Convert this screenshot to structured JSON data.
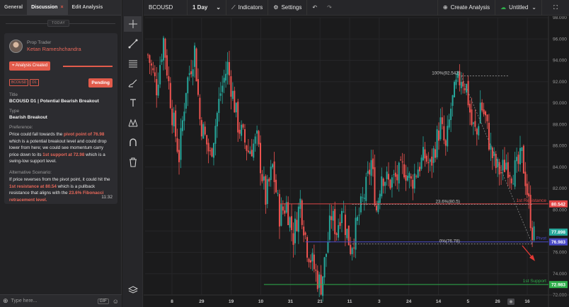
{
  "tabs": [
    {
      "label": "General"
    },
    {
      "label": "Discussion",
      "close": "×"
    },
    {
      "label": "Edit Analysis"
    }
  ],
  "today_label": "TODAY",
  "card": {
    "role": "Prop Trader",
    "name": "Ketan Rameshchandra",
    "status": "Analysis Created",
    "symbol_tag": "BCOUSD",
    "tf_tag": "D1",
    "pending": "Pending",
    "title_label": "Title",
    "title": "BCOUSD D1 | Potential Bearish Breakout",
    "type_label": "Type",
    "type": "Bearish Breakout",
    "pref_label": "Preference:",
    "pref": {
      "p1": "Price could fall towards the ",
      "h1": "pivot point of 76.98",
      "p2": " which is a potential breakout level and could drop lower from here; we could see momentum carry price down to its ",
      "h2": "1st support at 72.98",
      "p3": " which is a swing-low support level."
    },
    "alt_label": "Alternative Scenario:",
    "alt": {
      "p1": "If price reverses from the pivot point, it could hit the ",
      "h1": "1st resistance at 80.54",
      "p2": " which is a pullback resistance that aligns with the ",
      "h2": "23.6% Fibonacci retracement level.",
      "p3": ""
    },
    "time": "11:32"
  },
  "reply": {
    "placeholder": "Type here...",
    "gif": "GIF"
  },
  "toolbar": {
    "symbol": "BCOUSD",
    "interval": "1 Day",
    "indicators": "Indicators",
    "settings": "Settings",
    "create": "Create Analysis",
    "layout": "Untitled"
  },
  "icons": {
    "tools": [
      "crosshair-icon",
      "trend-line-icon",
      "fib-lines-icon",
      "brush-icon",
      "text-icon",
      "pattern-icon",
      "magnet-icon",
      "trash-icon"
    ],
    "bottom": "layers-icon"
  },
  "colors": {
    "up": "#26a69a",
    "down": "#ef5350",
    "resistance": "#e04646",
    "pivot": "#4a4ac8",
    "support": "#2fae4b",
    "accent": "#e25b4b"
  },
  "chart_data": {
    "type": "candlestick",
    "symbol": "BCOUSD",
    "interval": "1 Day",
    "y_ticks": [
      72,
      74,
      76,
      78,
      80,
      82,
      84,
      86,
      88,
      90,
      92,
      94,
      96,
      98
    ],
    "ylim": [
      72,
      98
    ],
    "x_ticks": [
      "8",
      "29",
      "19",
      "10",
      "31",
      "21",
      "11",
      "3",
      "24",
      "14",
      "5",
      "26",
      "16"
    ],
    "levels": [
      {
        "name": "1st Resistance",
        "value": 80.54,
        "label": "80.542",
        "color": "#e04646"
      },
      {
        "name": "Pivot",
        "value": 76.98,
        "label": "76.983",
        "color": "#4a4ac8"
      },
      {
        "name": "1st Support",
        "value": 72.98,
        "label": "72.983",
        "color": "#2fae4b"
      }
    ],
    "last_price": "77.898",
    "fibonacci": [
      {
        "label": "100%(92.542)",
        "value": 92.542
      },
      {
        "label": "23.6%(80.5)",
        "value": 80.5
      },
      {
        "label": "0%(76.78)",
        "value": 76.78
      }
    ],
    "path": [
      [
        0,
        94.5
      ],
      [
        5,
        91.5
      ],
      [
        9,
        96.0
      ],
      [
        14,
        89.0
      ],
      [
        18,
        85.0
      ],
      [
        22,
        91.5
      ],
      [
        27,
        95.0
      ],
      [
        30,
        88.5
      ],
      [
        36,
        85.0
      ],
      [
        42,
        91.0
      ],
      [
        46,
        93.5
      ],
      [
        52,
        88.0
      ],
      [
        58,
        85.5
      ],
      [
        63,
        86.5
      ],
      [
        68,
        81.0
      ],
      [
        72,
        84.0
      ],
      [
        76,
        79.5
      ],
      [
        80,
        80.5
      ],
      [
        84,
        77.5
      ],
      [
        88,
        80.8
      ],
      [
        92,
        76.5
      ],
      [
        95,
        75.0
      ],
      [
        98,
        73.5
      ],
      [
        100,
        73.0
      ],
      [
        103,
        76.0
      ],
      [
        106,
        79.5
      ],
      [
        109,
        78.0
      ],
      [
        112,
        80.5
      ],
      [
        114,
        78.5
      ],
      [
        117,
        76.5
      ],
      [
        119,
        77.5
      ],
      [
        122,
        79.5
      ],
      [
        126,
        82.0
      ],
      [
        129,
        84.5
      ],
      [
        132,
        80.0
      ],
      [
        135,
        83.5
      ],
      [
        139,
        82.5
      ],
      [
        144,
        83.0
      ],
      [
        148,
        84.0
      ],
      [
        152,
        82.5
      ],
      [
        156,
        84.0
      ],
      [
        160,
        85.0
      ],
      [
        163,
        84.0
      ],
      [
        166,
        86.0
      ],
      [
        169,
        88.0
      ],
      [
        172,
        85.5
      ],
      [
        175,
        89.5
      ],
      [
        178,
        91.5
      ],
      [
        181,
        92.5
      ],
      [
        184,
        91.5
      ],
      [
        187,
        88.0
      ],
      [
        190,
        87.0
      ],
      [
        192,
        90.0
      ],
      [
        195,
        88.5
      ],
      [
        198,
        85.5
      ],
      [
        201,
        84.0
      ],
      [
        204,
        83.5
      ],
      [
        207,
        84.5
      ],
      [
        210,
        83.5
      ],
      [
        213,
        83.8
      ],
      [
        216,
        85.0
      ],
      [
        218,
        83.0
      ],
      [
        220,
        80.5
      ],
      [
        222,
        78.0
      ],
      [
        223,
        77.5
      ]
    ]
  }
}
